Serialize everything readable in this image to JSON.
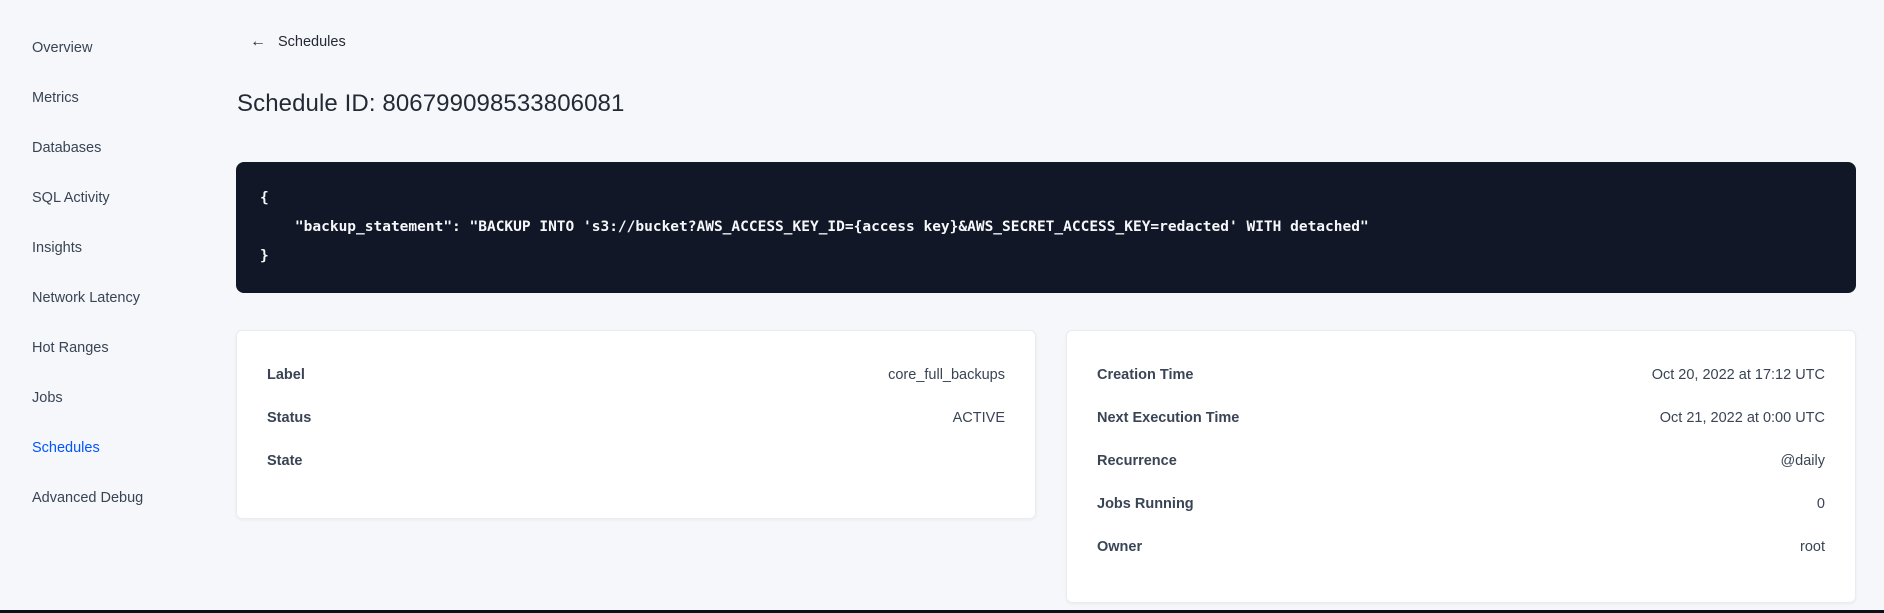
{
  "sidebar": {
    "items": [
      {
        "label": "Overview",
        "active": false
      },
      {
        "label": "Metrics",
        "active": false
      },
      {
        "label": "Databases",
        "active": false
      },
      {
        "label": "SQL Activity",
        "active": false
      },
      {
        "label": "Insights",
        "active": false
      },
      {
        "label": "Network Latency",
        "active": false
      },
      {
        "label": "Hot Ranges",
        "active": false
      },
      {
        "label": "Jobs",
        "active": false
      },
      {
        "label": "Schedules",
        "active": true
      },
      {
        "label": "Advanced Debug",
        "active": false
      }
    ],
    "active_color": "#0055ff"
  },
  "header": {
    "back_arrow": "←",
    "back_label": "Schedules",
    "title": "Schedule ID: 806799098533806081"
  },
  "code": {
    "lines": [
      "{",
      "    \"backup_statement\": \"BACKUP INTO 's3://bucket?AWS_ACCESS_KEY_ID={access key}&AWS_SECRET_ACCESS_KEY=redacted' WITH detached\"",
      "}"
    ],
    "background": "#111726",
    "text_color": "#f5f7fa"
  },
  "cards": {
    "left": {
      "rows": [
        {
          "label": "Label",
          "value": "core_full_backups"
        },
        {
          "label": "Status",
          "value": "ACTIVE"
        },
        {
          "label": "State",
          "value": ""
        }
      ]
    },
    "right": {
      "rows": [
        {
          "label": "Creation Time",
          "value": "Oct 20, 2022 at 17:12 UTC"
        },
        {
          "label": "Next Execution Time",
          "value": "Oct 21, 2022 at 0:00 UTC"
        },
        {
          "label": "Recurrence",
          "value": "@daily"
        },
        {
          "label": "Jobs Running",
          "value": "0"
        },
        {
          "label": "Owner",
          "value": "root"
        }
      ]
    }
  }
}
